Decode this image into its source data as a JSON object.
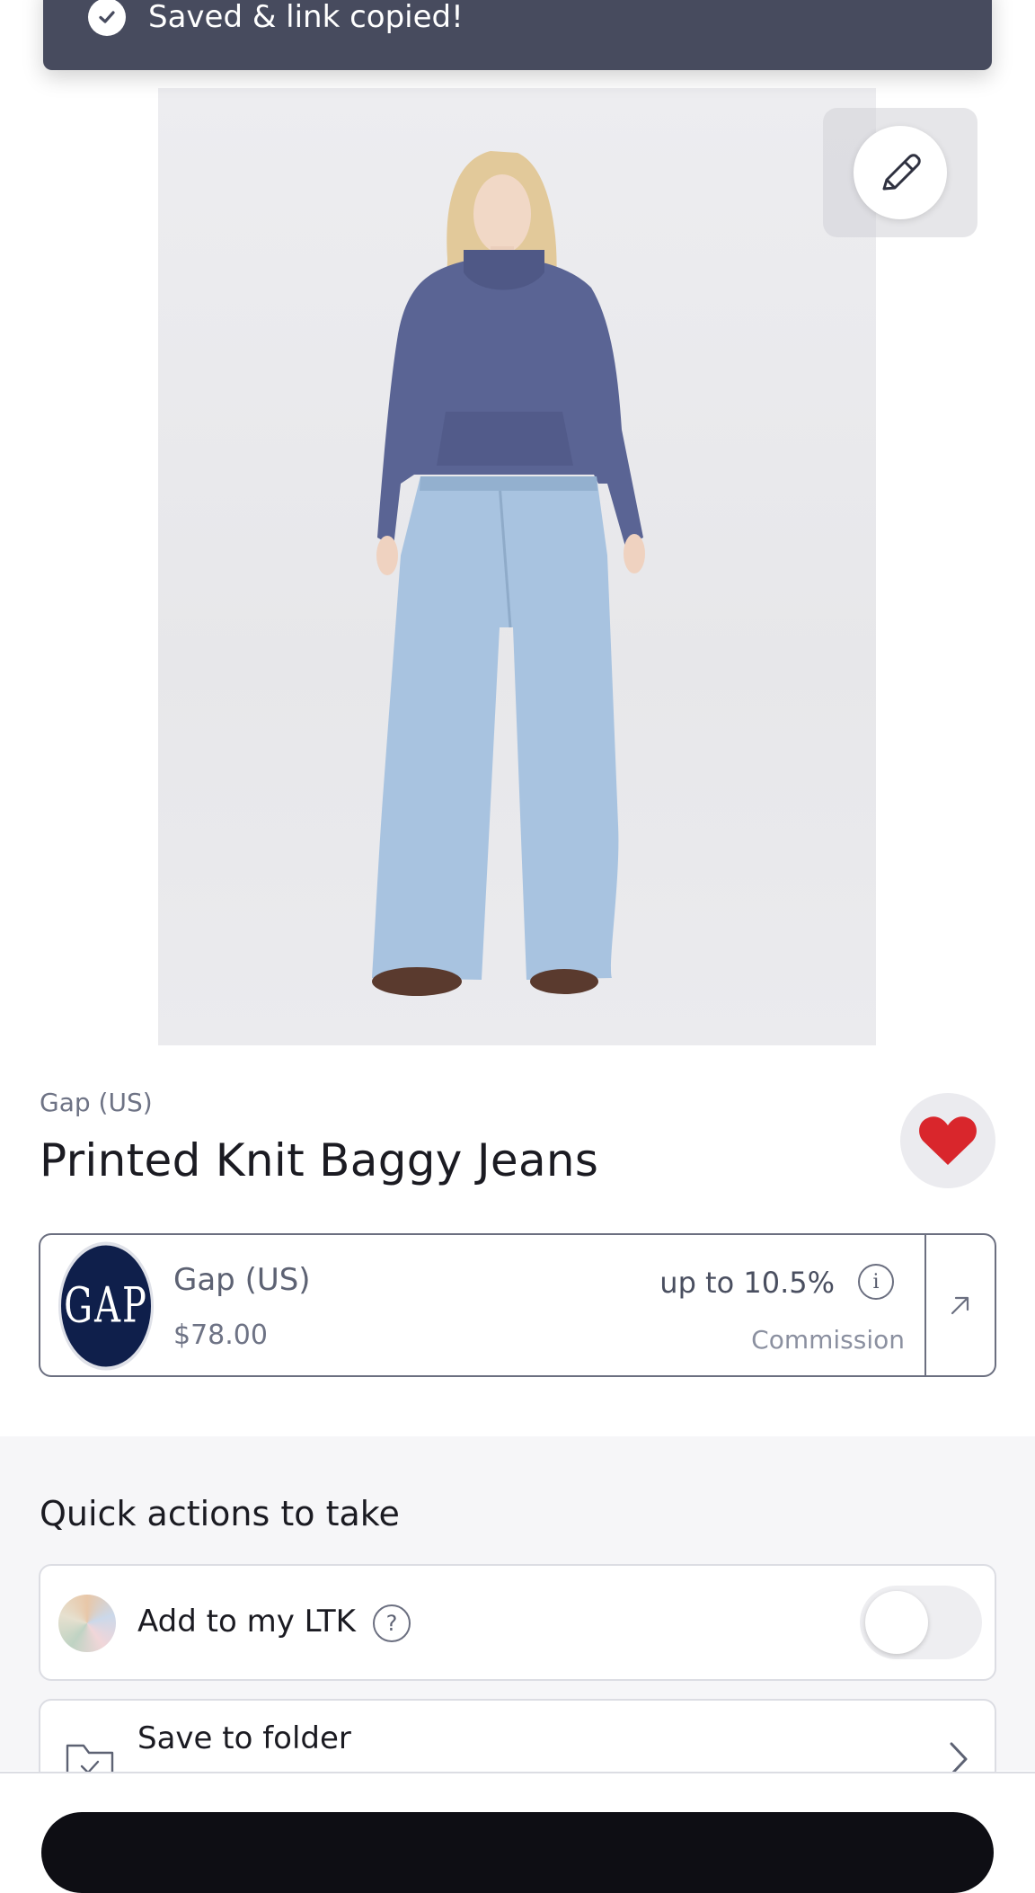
{
  "toast": {
    "message": "Saved & link copied!"
  },
  "product": {
    "retailer": "Gap (US)",
    "title": "Printed Knit Baggy Jeans",
    "favorited": true
  },
  "retailer_card": {
    "logo_text": "GAP",
    "name": "Gap (US)",
    "price": "$78.00",
    "commission_rate": "up to 10.5%",
    "commission_label": "Commission"
  },
  "quick_actions": {
    "title": "Quick actions to take",
    "add_to_ltk": {
      "label": "Add to my LTK",
      "help": "?",
      "enabled": false
    },
    "save_to_folder": {
      "label": "Save to folder"
    }
  },
  "colors": {
    "toast_bg": "#474b5e",
    "heart": "#d9262c",
    "gap_navy": "#0f1f4b",
    "section_bg": "#f6f6f8"
  }
}
